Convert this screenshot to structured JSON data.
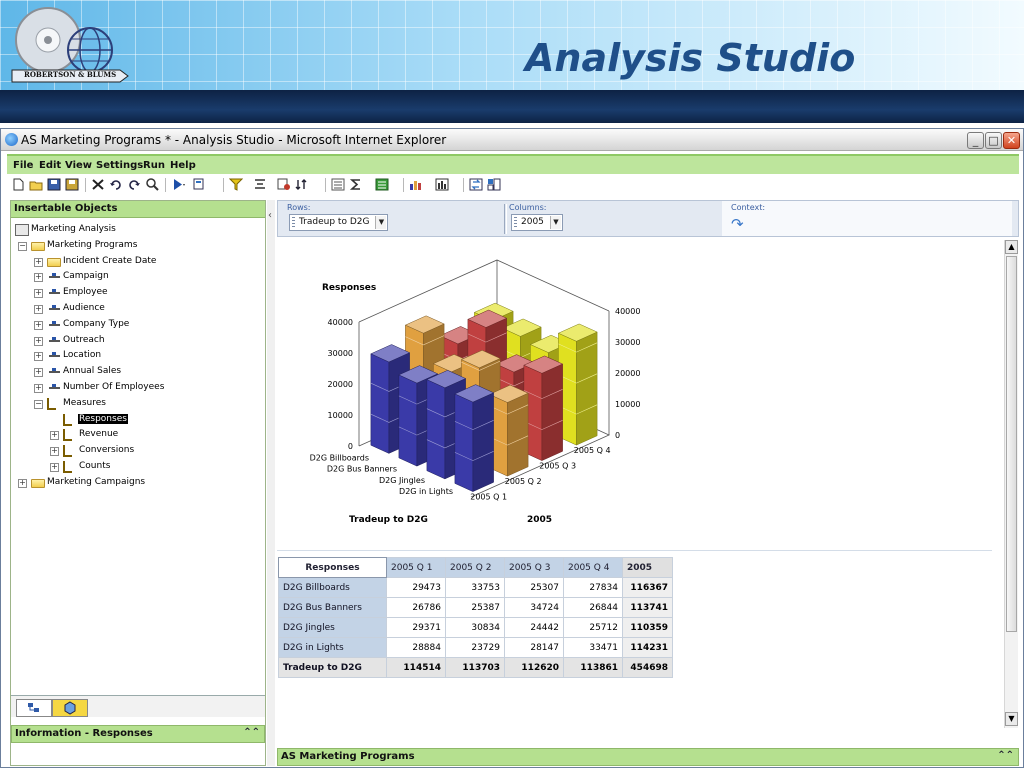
{
  "slide": {
    "title": "Analysis Studio",
    "logo_text": "ROBERTSON & BLUMS"
  },
  "window": {
    "title": "AS Marketing Programs * - Analysis Studio - Microsoft Internet Explorer"
  },
  "menu": [
    "File",
    "Edit",
    "View",
    "Settings",
    "Run",
    "Help"
  ],
  "left_panel": {
    "header": "Insertable Objects",
    "info_header": "Information - Responses",
    "tree": [
      {
        "label": "Marketing Analysis",
        "icon": "cube-icon",
        "depth": 0,
        "expander": ""
      },
      {
        "label": "Marketing Programs",
        "icon": "folder-icon",
        "depth": 1,
        "expander": "−"
      },
      {
        "label": "Incident Create Date",
        "icon": "folder-icon",
        "depth": 2,
        "expander": "+"
      },
      {
        "label": "Campaign",
        "icon": "dimension-icon",
        "depth": 2,
        "expander": "+"
      },
      {
        "label": "Employee",
        "icon": "dimension-icon",
        "depth": 2,
        "expander": "+"
      },
      {
        "label": "Audience",
        "icon": "dimension-icon",
        "depth": 2,
        "expander": "+"
      },
      {
        "label": "Company Type",
        "icon": "dimension-icon",
        "depth": 2,
        "expander": "+"
      },
      {
        "label": "Outreach",
        "icon": "dimension-icon",
        "depth": 2,
        "expander": "+"
      },
      {
        "label": "Location",
        "icon": "dimension-icon",
        "depth": 2,
        "expander": "+"
      },
      {
        "label": "Annual Sales",
        "icon": "dimension-icon",
        "depth": 2,
        "expander": "+"
      },
      {
        "label": "Number Of Employees",
        "icon": "dimension-icon",
        "depth": 2,
        "expander": "+"
      },
      {
        "label": "Measures",
        "icon": "measures-icon",
        "depth": 2,
        "expander": "−"
      },
      {
        "label": "Responses",
        "icon": "measure-icon",
        "depth": 3,
        "expander": "",
        "selected": true
      },
      {
        "label": "Revenue",
        "icon": "measure-icon",
        "depth": 3,
        "expander": "+"
      },
      {
        "label": "Conversions",
        "icon": "measure-icon",
        "depth": 3,
        "expander": "+"
      },
      {
        "label": "Counts",
        "icon": "measure-icon",
        "depth": 3,
        "expander": "+"
      },
      {
        "label": "Marketing Campaigns",
        "icon": "folder-icon",
        "depth": 1,
        "expander": "+"
      }
    ]
  },
  "overview": {
    "rows_label": "Rows:",
    "rows_value": "Tradeup to D2G",
    "columns_label": "Columns:",
    "columns_value": "2005",
    "context_label": "Context:"
  },
  "right_info": "AS Marketing Programs",
  "grid": {
    "corner": "Responses",
    "columns": [
      "2005 Q 1",
      "2005 Q 2",
      "2005 Q 3",
      "2005 Q 4",
      "2005"
    ],
    "rows": [
      {
        "label": "D2G Billboards",
        "values": [
          "29473",
          "33753",
          "25307",
          "27834"
        ],
        "total": "116367"
      },
      {
        "label": "D2G Bus Banners",
        "values": [
          "26786",
          "25387",
          "34724",
          "26844"
        ],
        "total": "113741"
      },
      {
        "label": "D2G Jingles",
        "values": [
          "29371",
          "30834",
          "24442",
          "25712"
        ],
        "total": "110359"
      },
      {
        "label": "D2G in Lights",
        "values": [
          "28884",
          "23729",
          "28147",
          "33471"
        ],
        "total": "114231"
      }
    ],
    "total_row": {
      "label": "Tradeup to D2G",
      "values": [
        "114514",
        "113703",
        "112620",
        "113861"
      ],
      "total": "454698"
    }
  },
  "chart_data": {
    "type": "bar",
    "subtype": "3d-column",
    "title": "Responses",
    "xlabel": "Tradeup to D2G",
    "zlabel": "2005",
    "categories": [
      "D2G Billboards",
      "D2G Bus Banners",
      "D2G Jingles",
      "D2G in Lights"
    ],
    "series": [
      {
        "name": "2005 Q 1",
        "values": [
          29473,
          26786,
          29371,
          28884
        ]
      },
      {
        "name": "2005 Q 2",
        "values": [
          33753,
          25387,
          30834,
          23729
        ]
      },
      {
        "name": "2005 Q 3",
        "values": [
          25307,
          34724,
          24442,
          28147
        ]
      },
      {
        "name": "2005 Q 4",
        "values": [
          27834,
          26844,
          25712,
          33471
        ]
      }
    ],
    "y_ticks": [
      0,
      10000,
      20000,
      30000,
      40000
    ],
    "ylim": [
      0,
      40000
    ],
    "colors": [
      "#3a3aa8",
      "#e0a040",
      "#c04040",
      "#e0e020"
    ]
  }
}
